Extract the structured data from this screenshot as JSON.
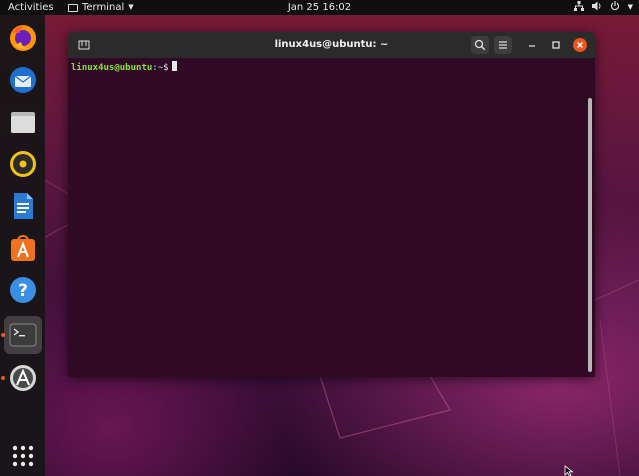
{
  "topbar": {
    "activities_label": "Activities",
    "app_menu_label": "Terminal",
    "clock": "Jan 25  16:02",
    "tray_icons": [
      "network-icon",
      "volume-icon",
      "power-icon",
      "chevron-down-icon"
    ]
  },
  "dock": {
    "items": [
      {
        "name": "firefox",
        "icon": "firefox-icon",
        "running": false
      },
      {
        "name": "thunderbird",
        "icon": "thunderbird-icon",
        "running": false
      },
      {
        "name": "files",
        "icon": "files-icon",
        "running": false
      },
      {
        "name": "rhythmbox",
        "icon": "rhythmbox-icon",
        "running": false
      },
      {
        "name": "libreoffice-writer",
        "icon": "writer-icon",
        "running": false
      },
      {
        "name": "ubuntu-software",
        "icon": "software-store-icon",
        "running": false
      },
      {
        "name": "help",
        "icon": "help-icon",
        "running": false
      },
      {
        "name": "terminal",
        "icon": "terminal-icon",
        "running": true,
        "active": true
      },
      {
        "name": "software-updater",
        "icon": "software-updater-icon",
        "running": true
      }
    ],
    "show_apps_icon": "app-grid-icon"
  },
  "terminal": {
    "title": "linux4us@ubuntu: ~",
    "prompt_user": "linux4us@ubuntu",
    "prompt_path": ":~",
    "prompt_symbol": "$",
    "colors": {
      "background": "#300a24",
      "user": "#8ae234",
      "path": "#729fcf",
      "close_button": "#e95420"
    }
  },
  "colors": {
    "accent": "#e95420",
    "topbar": "#0f0f0f"
  }
}
